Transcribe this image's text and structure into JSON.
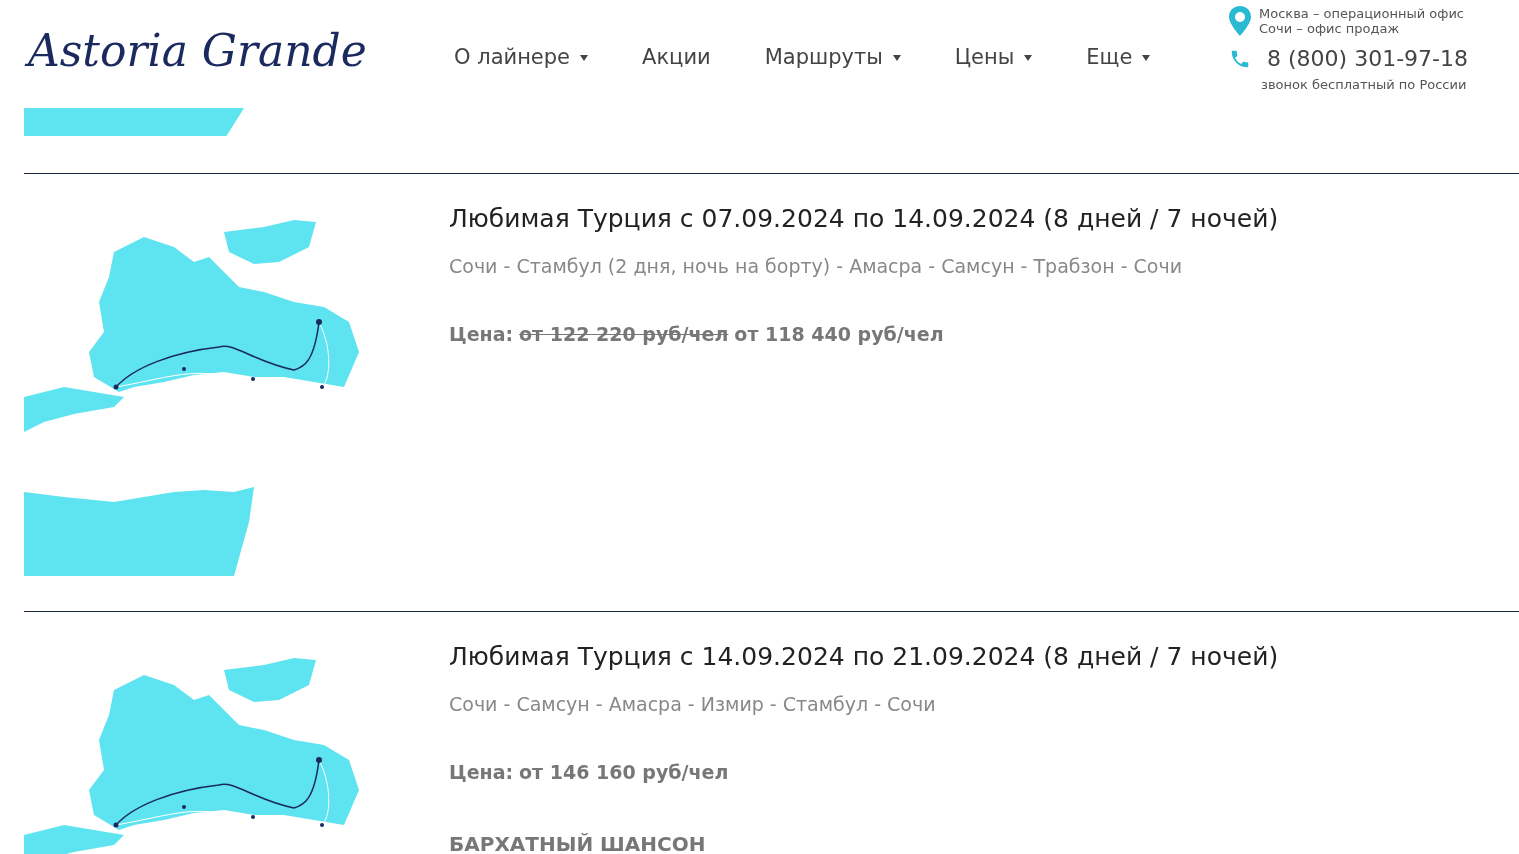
{
  "header": {
    "logo": "Astoria Grande",
    "nav": [
      {
        "label": "О лайнере",
        "dropdown": true
      },
      {
        "label": "Акции",
        "dropdown": false
      },
      {
        "label": "Маршруты",
        "dropdown": true
      },
      {
        "label": "Цены",
        "dropdown": true
      },
      {
        "label": "Еще",
        "dropdown": true
      }
    ],
    "offices": [
      "Москва – операционный офис",
      "Сочи – офис продаж"
    ],
    "phone": "8 (800) 301-97-18",
    "phone_note": "звонок бесплатный по России"
  },
  "cruises": [
    {
      "title": "Любимая Турция с 07.09.2024 по 14.09.2024 (8 дней / 7 ночей)",
      "route": "Сочи - Стамбул (2 дня, ночь на борту) - Амасра - Самсун - Трабзон - Сочи",
      "price_label": "Цена:",
      "old_price": "от 122 220 руб/чел",
      "price": "от 118 440 руб/чел"
    },
    {
      "title": "Любимая Турция с 14.09.2024 по 21.09.2024 (8 дней / 7 ночей)",
      "route": "Сочи - Самсун - Амасра - Измир - Стамбул - Сочи",
      "price_label": "Цена:",
      "price": "от 146 160 руб/чел",
      "tag": "БАРХАТНЫЙ ШАНСОН"
    }
  ]
}
